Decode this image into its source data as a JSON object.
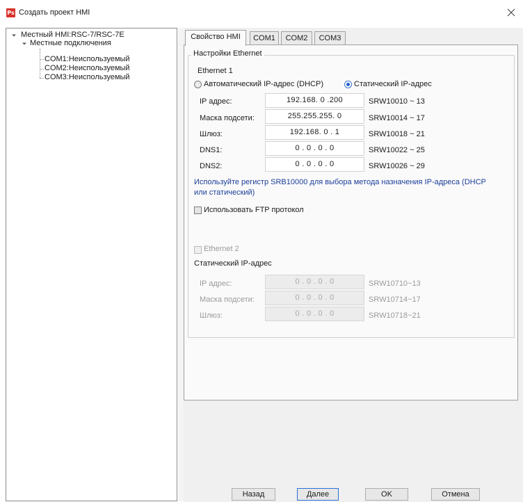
{
  "window": {
    "title": "Создать проект HMI",
    "app_icon": "Ps"
  },
  "tree": {
    "root": "Местный HMI:RSC-7/RSC-7E",
    "group": "Местные подключения",
    "items": [
      "COM1:Неиспользуемый",
      "COM2:Неиспользуемый",
      "COM3:Неиспользуемый"
    ]
  },
  "tabs": [
    {
      "label": "Свойство HMI",
      "active": true
    },
    {
      "label": "COM1",
      "active": false
    },
    {
      "label": "COM2",
      "active": false
    },
    {
      "label": "COM3",
      "active": false
    }
  ],
  "ethernet_settings": {
    "group_title": "Настройки Ethernet",
    "eth1_label": "Ethernet 1",
    "radio_dhcp": "Автоматический IP-адрес (DHCP)",
    "radio_static": "Статический IP-адрес",
    "selected_mode": "static",
    "rows": [
      {
        "label": "IP адрес:",
        "value": "192.168. 0 .200",
        "register": "SRW10010 ~ 13"
      },
      {
        "label": "Маска подсети:",
        "value": "255.255.255. 0",
        "register": "SRW10014 ~ 17"
      },
      {
        "label": "Шлюз:",
        "value": "192.168. 0 . 1",
        "register": "SRW10018 ~ 21"
      },
      {
        "label": "DNS1:",
        "value": "0 . 0 . 0 . 0",
        "register": "SRW10022 ~ 25"
      },
      {
        "label": "DNS2:",
        "value": "0 . 0 . 0 . 0",
        "register": "SRW10026 ~ 29"
      }
    ],
    "note": "Используйте регистр SRB10000 для выбора метода назначения IP-адреса (DHCP или статический)",
    "ftp_label": "Использовать FTP протокол",
    "ftp_checked": false,
    "eth2_label": "Ethernet 2",
    "eth2_checked": false,
    "eth2_static_label": "Статический IP-адрес",
    "eth2_rows": [
      {
        "label": "IP адрес:",
        "value": "0 . 0 . 0 . 0",
        "register": "SRW10710~13"
      },
      {
        "label": "Маска подсети:",
        "value": "0 . 0 . 0 . 0",
        "register": "SRW10714~17"
      },
      {
        "label": "Шлюз:",
        "value": "0 . 0 . 0 . 0",
        "register": "SRW10718~21"
      }
    ]
  },
  "buttons": {
    "back": "Назад",
    "next": "Далее",
    "ok": "OK",
    "cancel": "Отмена"
  },
  "colors": {
    "accent": "#1d5fc9",
    "note_text": "#1b3e9a",
    "app_icon_bg": "#d8322b"
  }
}
